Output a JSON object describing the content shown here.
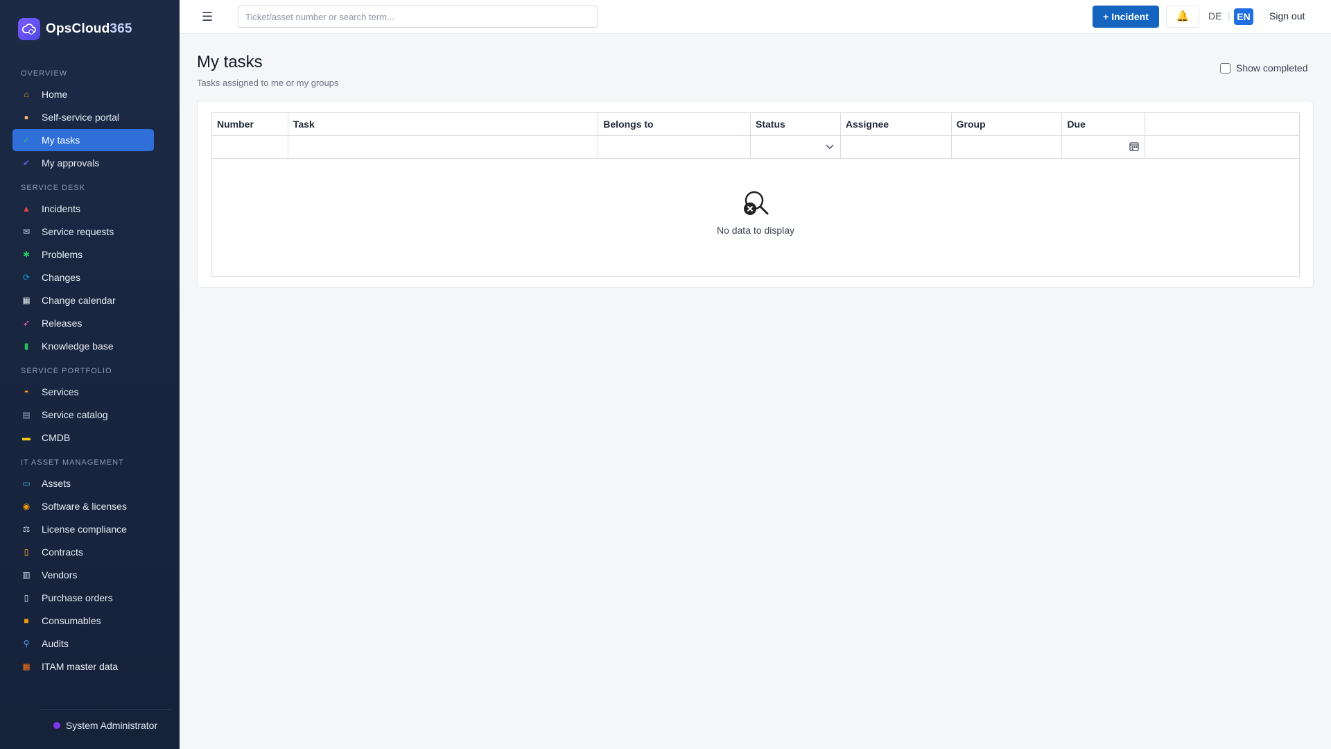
{
  "brand": {
    "name": "OpsCloud",
    "suffix": "365"
  },
  "sections": [
    {
      "label": "OVERVIEW",
      "items": [
        {
          "label": "Home",
          "icon": "home-icon",
          "color": "#f59e0b",
          "glyph": "⌂"
        },
        {
          "label": "Self-service portal",
          "icon": "person-icon",
          "color": "#f6b26b",
          "glyph": "●"
        },
        {
          "label": "My tasks",
          "icon": "check-box-icon",
          "color": "#22c55e",
          "glyph": "✓",
          "active": true
        },
        {
          "label": "My approvals",
          "icon": "checkmark-icon",
          "color": "#6d5ce7",
          "glyph": "✔"
        }
      ]
    },
    {
      "label": "SERVICE DESK",
      "items": [
        {
          "label": "Incidents",
          "icon": "siren-icon",
          "color": "#ef4444",
          "glyph": "▲"
        },
        {
          "label": "Service requests",
          "icon": "envelope-icon",
          "color": "#cbd5e1",
          "glyph": "✉"
        },
        {
          "label": "Problems",
          "icon": "puzzle-icon",
          "color": "#22c55e",
          "glyph": "✱"
        },
        {
          "label": "Changes",
          "icon": "refresh-icon",
          "color": "#0ea5e9",
          "glyph": "⟳"
        },
        {
          "label": "Change calendar",
          "icon": "calendar-icon",
          "color": "#e2e8f0",
          "glyph": "▦"
        },
        {
          "label": "Releases",
          "icon": "rocket-icon",
          "color": "#f472b6",
          "glyph": "➶"
        },
        {
          "label": "Knowledge base",
          "icon": "books-icon",
          "color": "#22c55e",
          "glyph": "▮"
        }
      ]
    },
    {
      "label": "SERVICE PORTFOLIO",
      "items": [
        {
          "label": "Services",
          "icon": "bell-service-icon",
          "color": "#f59e0b",
          "glyph": "◓"
        },
        {
          "label": "Service catalog",
          "icon": "register-icon",
          "color": "#94a3b8",
          "glyph": "▤"
        },
        {
          "label": "CMDB",
          "icon": "folder-icon",
          "color": "#facc15",
          "glyph": "▬"
        }
      ]
    },
    {
      "label": "IT ASSET MANAGEMENT",
      "items": [
        {
          "label": "Assets",
          "icon": "laptop-icon",
          "color": "#38bdf8",
          "glyph": "▭"
        },
        {
          "label": "Software & licenses",
          "icon": "disc-icon",
          "color": "#f59e0b",
          "glyph": "◉"
        },
        {
          "label": "License compliance",
          "icon": "scales-icon",
          "color": "#cbd5e1",
          "glyph": "⚖"
        },
        {
          "label": "Contracts",
          "icon": "scroll-icon",
          "color": "#fbbf24",
          "glyph": "▯"
        },
        {
          "label": "Vendors",
          "icon": "building-icon",
          "color": "#cbd5e1",
          "glyph": "▥"
        },
        {
          "label": "Purchase orders",
          "icon": "receipt-icon",
          "color": "#e5e7eb",
          "glyph": "▯"
        },
        {
          "label": "Consumables",
          "icon": "box-icon",
          "color": "#f59e0b",
          "glyph": "■"
        },
        {
          "label": "Audits",
          "icon": "magnifier-icon",
          "color": "#60a5fa",
          "glyph": "⚲"
        },
        {
          "label": "ITAM master data",
          "icon": "bricks-icon",
          "color": "#f97316",
          "glyph": "▦"
        }
      ]
    }
  ],
  "footer": {
    "user": "System Administrator"
  },
  "topbar": {
    "search_placeholder": "Ticket/asset number or search term...",
    "incident_label": "+ Incident",
    "lang_de": "DE",
    "lang_sep": "|",
    "lang_en": "EN",
    "signout_label": "Sign out"
  },
  "page": {
    "title": "My tasks",
    "subtitle": "Tasks assigned to me or my groups",
    "show_completed_label": "Show completed",
    "show_completed_checked": false
  },
  "table": {
    "columns": [
      "Number",
      "Task",
      "Belongs to",
      "Status",
      "Assignee",
      "Group",
      "Due",
      ""
    ],
    "empty_text": "No data to display"
  }
}
